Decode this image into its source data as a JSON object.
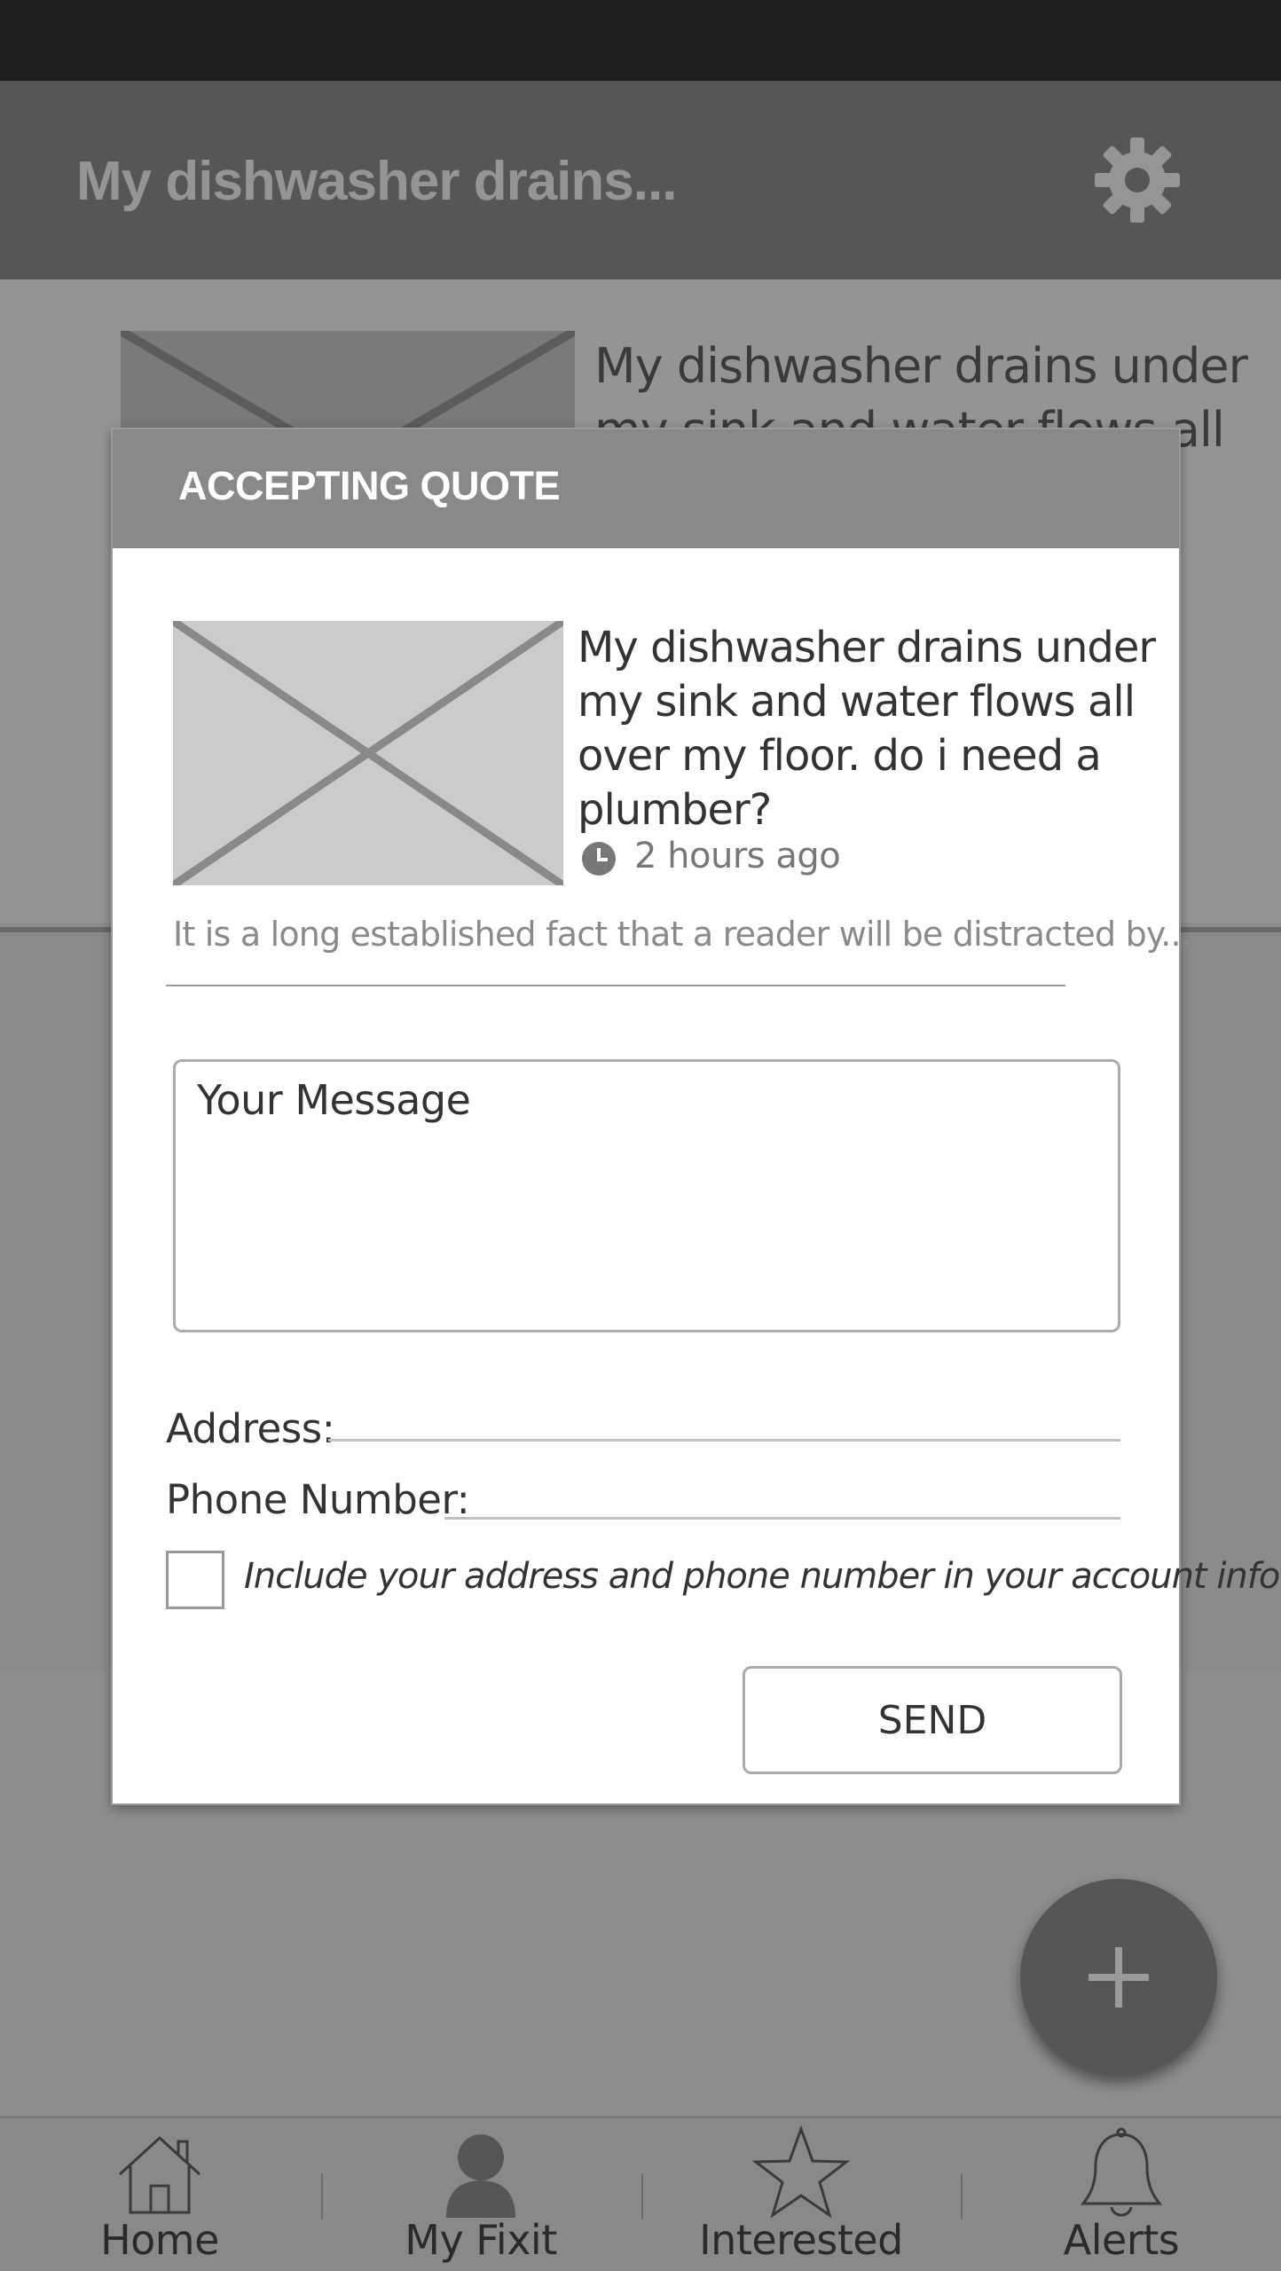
{
  "app_bar": {
    "title": "My dishwasher drains...",
    "settings_icon": "gear-icon"
  },
  "background_card": {
    "text": "My dishwasher drains under my sink and water flows all over my"
  },
  "dialog": {
    "title": "ACCEPTING QUOTE",
    "question": "My dishwasher drains under my sink and water flows all over my floor. do i need a plumber?",
    "time": "2 hours ago",
    "description": "It is a long established fact that a reader will be distracted by...",
    "message_placeholder": "Your Message",
    "address_label": "Address:",
    "phone_label": "Phone Number:",
    "checkbox_label": "Include your address and phone number in your account info.",
    "send_label": "SEND"
  },
  "fab": {
    "icon": "plus-icon"
  },
  "bottom_nav": {
    "items": [
      {
        "label": "Home",
        "icon": "home-icon"
      },
      {
        "label": "My Fixit",
        "icon": "person-icon"
      },
      {
        "label": "Interested",
        "icon": "star-icon"
      },
      {
        "label": "Alerts",
        "icon": "bell-icon"
      }
    ]
  },
  "colors": {
    "status_bar": "#1e1e1e",
    "app_bar": "#575657",
    "dialog_header": "#8a898a",
    "fab": "#575657",
    "overlay": "#8f8e8f"
  }
}
